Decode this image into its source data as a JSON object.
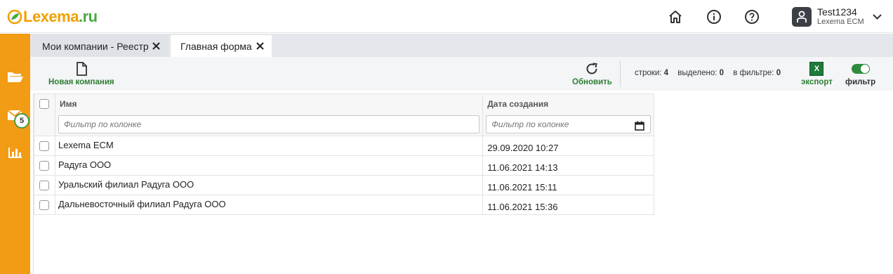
{
  "header": {
    "logo_text": "Lexema",
    "logo_dot": ".ru",
    "icons": [
      "home-icon",
      "info-icon",
      "help-icon"
    ],
    "user": {
      "name": "Test1234",
      "org": "Lexema ECM"
    }
  },
  "sidebar": {
    "items": [
      "folder-icon",
      "mail-icon",
      "chart-icon"
    ],
    "mail_badge": "5"
  },
  "tabs": [
    {
      "label": "Мои компании - Реестр",
      "active": false
    },
    {
      "label": "Главная форма",
      "active": true
    }
  ],
  "toolbar": {
    "new_company": "Новая компания",
    "refresh": "Обновить",
    "stats": {
      "rows_label": "строки:",
      "rows": "4",
      "selected_label": "выделено:",
      "selected": "0",
      "filtered_label": "в фильтре:",
      "filtered": "0"
    },
    "excel_letter": "X",
    "export": "экспорт",
    "filter": "фильтр"
  },
  "table": {
    "columns": [
      "Имя",
      "Дата создания"
    ],
    "filter_placeholder": "Фильтр по колонке",
    "rows": [
      {
        "name": "Lexema ECM",
        "date": "29.09.2020 10:27"
      },
      {
        "name": "Радуга ООО",
        "date": "11.06.2021 14:13"
      },
      {
        "name": "Уральский филиал Радуга ООО",
        "date": "11.06.2021 15:11"
      },
      {
        "name": "Дальневосточный филиал Радуга ООО",
        "date": "11.06.2021 15:36"
      }
    ]
  },
  "colors": {
    "brand_orange": "#f29b15",
    "brand_green": "#49a942",
    "action_green": "#2e7d32"
  }
}
